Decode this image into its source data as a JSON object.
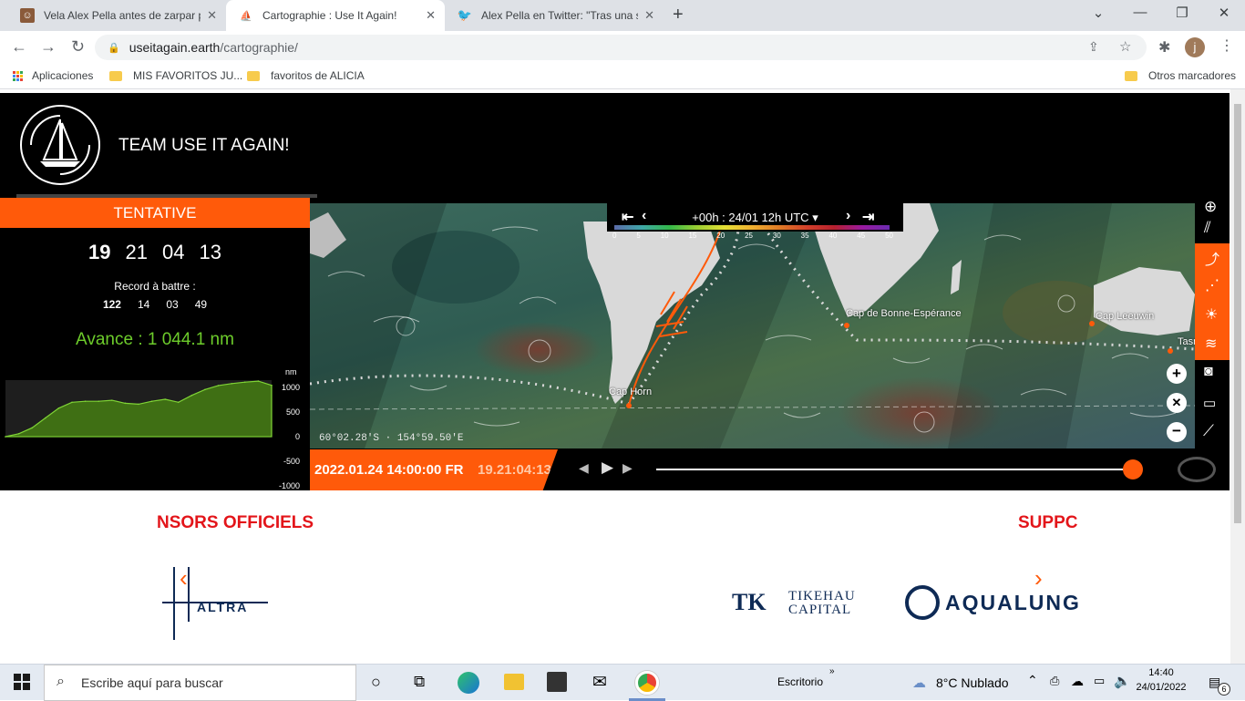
{
  "browser": {
    "tabs": [
      {
        "title": "Vela Alex Pella antes de zarpar pa",
        "icon": "profile-icon"
      },
      {
        "title": "Cartographie : Use It Again!",
        "icon": "boat-icon"
      },
      {
        "title": "Alex Pella en Twitter: \"Tras una se",
        "icon": "twitter-icon"
      }
    ],
    "url_domain": "useitagain.earth",
    "url_path": "/cartographie/",
    "profile_initial": "j",
    "bookmarks": [
      "Aplicaciones",
      "MIS FAVORITOS JU...",
      "favoritos de ALICIA"
    ],
    "other_bookmarks": "Otros marcadores"
  },
  "site": {
    "team_name": "TEAM USE IT AGAIN!",
    "tentative_label": "TENTATIVE",
    "timer": [
      "19",
      "21",
      "04",
      "13"
    ],
    "record_label": "Record à battre :",
    "record": [
      "122",
      "14",
      "03",
      "49"
    ],
    "avance_label": "Avance :",
    "avance_value": "1 044.1 nm",
    "time_label": "+00h : 24/01 12h UTC",
    "wind_scale": [
      "0",
      "5",
      "10",
      "15",
      "20",
      "25",
      "30",
      "35",
      "40",
      "45",
      "50"
    ],
    "coordinate": "60°02.28'S · 154°59.50'E",
    "places": [
      "Cap de Bonne-Espérance",
      "Cap Leeuwin",
      "Cap Horn",
      "Tasm"
    ],
    "play_date": "2022.01.24 14:00:00 FR",
    "play_elapsed": "19.21:04:13",
    "sponsors_title": "NSORS OFFICIELS",
    "supporters_title": "SUPPC",
    "sponsor_left": "ALTRA",
    "sponsor_tikehau_1": "TIKEHAU",
    "sponsor_tikehau_2": "CAPITAL",
    "sponsor_aqualung": "AQUALUNG"
  },
  "chart_data": {
    "type": "area",
    "ylabel": "nm",
    "yticks": [
      1000,
      500,
      0,
      -500,
      -1000
    ],
    "ylim": [
      -1000,
      1150
    ],
    "x": [
      0,
      1,
      2,
      3,
      4,
      5,
      6,
      7,
      8,
      9,
      10,
      11,
      12,
      13,
      14,
      15,
      16,
      17,
      18,
      19,
      20
    ],
    "values": [
      0,
      60,
      180,
      380,
      580,
      700,
      720,
      720,
      740,
      680,
      660,
      720,
      760,
      700,
      840,
      960,
      1040,
      1080,
      1110,
      1130,
      1044
    ]
  },
  "taskbar": {
    "search_placeholder": "Escribe aquí para buscar",
    "desktop_label": "Escritorio",
    "weather": "8°C  Nublado",
    "time": "14:40",
    "date": "24/01/2022",
    "notifications": "6"
  }
}
